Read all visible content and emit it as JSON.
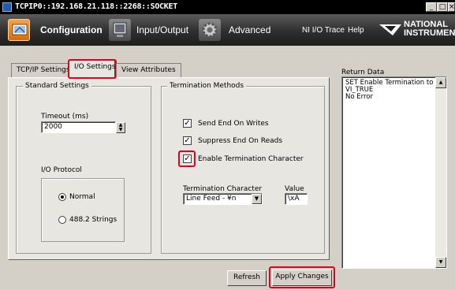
{
  "window": {
    "title": "TCPIP0::192.168.21.118::2268::SOCKET",
    "min_glyph": "_",
    "max_glyph": "□",
    "close_glyph": "×"
  },
  "toolbar": {
    "configuration": "Configuration",
    "input_output": "Input/Output",
    "advanced": "Advanced",
    "ni_io_trace": "NI I/O Trace",
    "help": "Help",
    "logo_line1": "NATIONAL",
    "logo_line2": "INSTRUMENTS"
  },
  "tabs": [
    {
      "label": "TCP/IP Settings",
      "active": false
    },
    {
      "label": "I/O Settings",
      "active": true
    },
    {
      "label": "View Attributes",
      "active": false
    }
  ],
  "standard": {
    "group_title": "Standard Settings",
    "timeout_label": "Timeout (ms)",
    "timeout_value": "2000",
    "protocol_label": "I/O Protocol",
    "protocol_options": [
      {
        "label": "Normal",
        "selected": true
      },
      {
        "label": "488.2 Strings",
        "selected": false
      }
    ]
  },
  "termination": {
    "group_title": "Termination Methods",
    "checks": [
      {
        "label": "Send End On Writes",
        "checked": true
      },
      {
        "label": "Suppress End On Reads",
        "checked": true
      },
      {
        "label": "Enable Termination Character",
        "checked": true
      }
    ],
    "char_label": "Termination Character",
    "char_value": "Line Feed - ¥n",
    "value_label": "Value",
    "value_value": "\\xA"
  },
  "return_data": {
    "label": "Return Data",
    "text": "SET Enable Termination to\nVI_TRUE\nNo Error"
  },
  "buttons": {
    "refresh": "Refresh",
    "apply": "Apply Changes"
  },
  "colors": {
    "highlight": "#e4001b",
    "toolbar_bg": "#2e2e2e",
    "window_bg": "#d4d0c8"
  }
}
